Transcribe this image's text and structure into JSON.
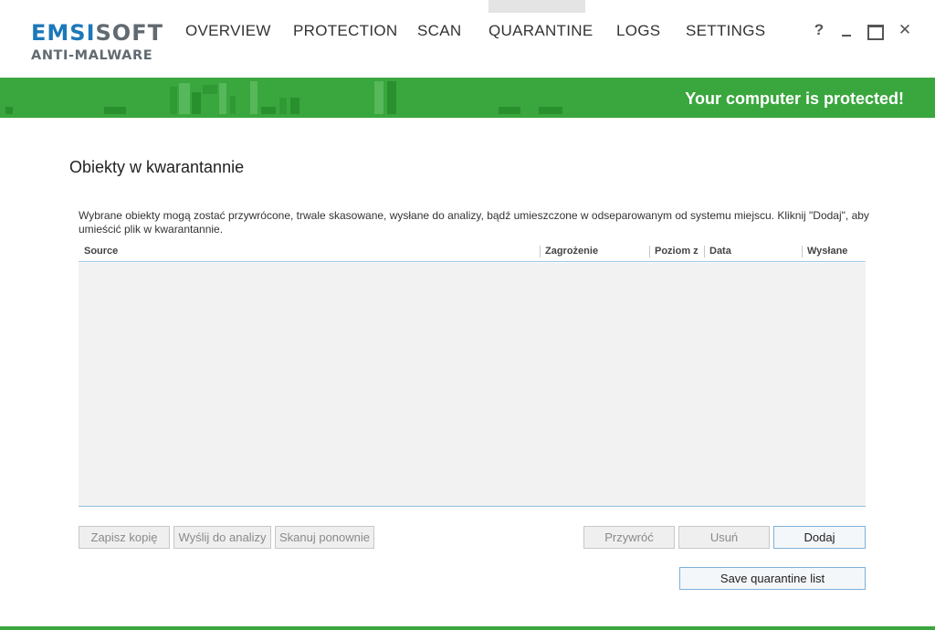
{
  "logo": {
    "part1": "EMSI",
    "part2": "SOFT",
    "subtitle": "ANTI-MALWARE"
  },
  "nav": {
    "overview": "OVERVIEW",
    "protection": "PROTECTION",
    "scan": "SCAN",
    "quarantine": "QUARANTINE",
    "logs": "LOGS",
    "settings": "SETTINGS",
    "active": "quarantine"
  },
  "window": {
    "help": "?",
    "close": "✕"
  },
  "status": {
    "text": "Your computer is protected!",
    "color": "#3aa63e"
  },
  "page": {
    "title": "Obiekty w kwarantannie",
    "description": "Wybrane obiekty mogą zostać przywrócone, trwale skasowane, wysłane do analizy, bądź umieszczone w odseparowanym od systemu miejscu. Kliknij \"Dodaj\", aby umieścić plik w kwarantannie."
  },
  "table": {
    "columns": {
      "source": "Source",
      "threat": "Zagrożenie",
      "level": "Poziom z",
      "date": "Data",
      "sent": "Wysłane"
    },
    "rows": []
  },
  "buttons": {
    "save_copy": "Zapisz kopię",
    "send_analysis": "Wyślij do analizy",
    "rescan": "Skanuj ponownie",
    "restore": "Przywróć",
    "delete": "Usuń",
    "add": "Dodaj",
    "save_list": "Save quarantine list"
  }
}
